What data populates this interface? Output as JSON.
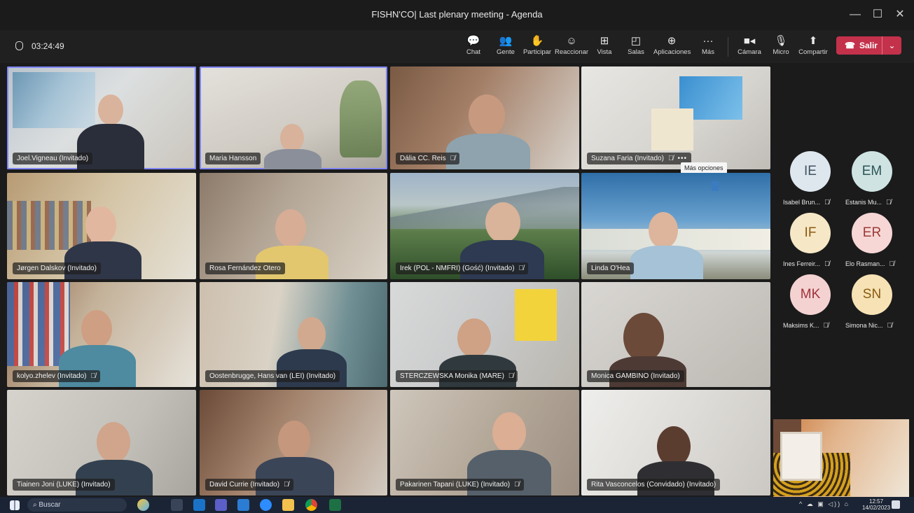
{
  "window": {
    "title": "FISHN'CO| Last plenary meeting - Agenda",
    "controls": [
      "—",
      "☐",
      "✕"
    ]
  },
  "meeting": {
    "elapsed": "03:24:49"
  },
  "toolbar": {
    "buttons": [
      {
        "label": "Chat",
        "icon": "💬"
      },
      {
        "label": "Gente",
        "icon": "👥"
      },
      {
        "label": "Participar",
        "icon": "✋"
      },
      {
        "label": "Reaccionar",
        "icon": "☺"
      },
      {
        "label": "Vista",
        "icon": "⊞"
      },
      {
        "label": "Salas",
        "icon": "◰"
      },
      {
        "label": "Aplicaciones",
        "icon": "⊕"
      },
      {
        "label": "Más",
        "icon": "···"
      },
      {
        "label": "Cámara",
        "icon": "■◂"
      },
      {
        "label": "Micro",
        "icon": "🎙"
      },
      {
        "label": "Compartir",
        "icon": "⬆"
      }
    ],
    "leave_label": "Salir",
    "leave_icon": "☎",
    "leave_caret": "⌄"
  },
  "tiles": [
    {
      "name": "Joel.Vigneau (Invitado)",
      "muted": false
    },
    {
      "name": "Maria Hansson",
      "muted": false
    },
    {
      "name": "Dália CC. Reis",
      "muted": true
    },
    {
      "name": "Suzana Faria (Invitado)",
      "muted": true
    },
    {
      "name": "Jørgen Dalskov (Invitado)",
      "muted": false
    },
    {
      "name": "Rosa Fernández Otero",
      "muted": false
    },
    {
      "name": "Irek (POL - NMFRI) (Gość) (Invitado)",
      "muted": true
    },
    {
      "name": "Linda O'Hea",
      "muted": false
    },
    {
      "name": "kolyo.zhelev (Invitado)",
      "muted": true
    },
    {
      "name": "Oostenbrugge, Hans van (LEI) (Invitado)",
      "muted": false
    },
    {
      "name": "STERCZEWSKA Monika (MARE)",
      "muted": true
    },
    {
      "name": "Monica GAMBINO (Invitado)",
      "muted": false
    },
    {
      "name": "Tiainen Joni (LUKE) (Invitado)",
      "muted": false
    },
    {
      "name": "David Currie (Invitado)",
      "muted": true
    },
    {
      "name": "Pakarinen Tapani (LUKE) (Invitado)",
      "muted": true
    },
    {
      "name": "Rita Vasconcelos (Convidado) (Invitado)",
      "muted": false
    }
  ],
  "tooltip": "Más opciones",
  "tile_more": "•••",
  "mute_icon": "🎙̸",
  "avatars": [
    {
      "initials": "IE",
      "name": "Isabel Brun...",
      "color": "#dfe7ee",
      "text_color": "#3f5263"
    },
    {
      "initials": "EM",
      "name": "Estanis Mu...",
      "color": "#cfe3e3",
      "text_color": "#2e5556"
    },
    {
      "initials": "IF",
      "name": "Ines Ferreir...",
      "color": "#f6e7c6",
      "text_color": "#8a5a12"
    },
    {
      "initials": "ER",
      "name": "Elo Rasman...",
      "color": "#f6d7d6",
      "text_color": "#9b3b36"
    },
    {
      "initials": "MK",
      "name": "Maksims K...",
      "color": "#f5d2d2",
      "text_color": "#a0323b"
    },
    {
      "initials": "SN",
      "name": "Simona Nic...",
      "color": "#f6e2b4",
      "text_color": "#8a5a12"
    }
  ],
  "taskbar": {
    "search_placeholder": "Buscar",
    "time": "12:57",
    "date": "14/02/2023"
  }
}
